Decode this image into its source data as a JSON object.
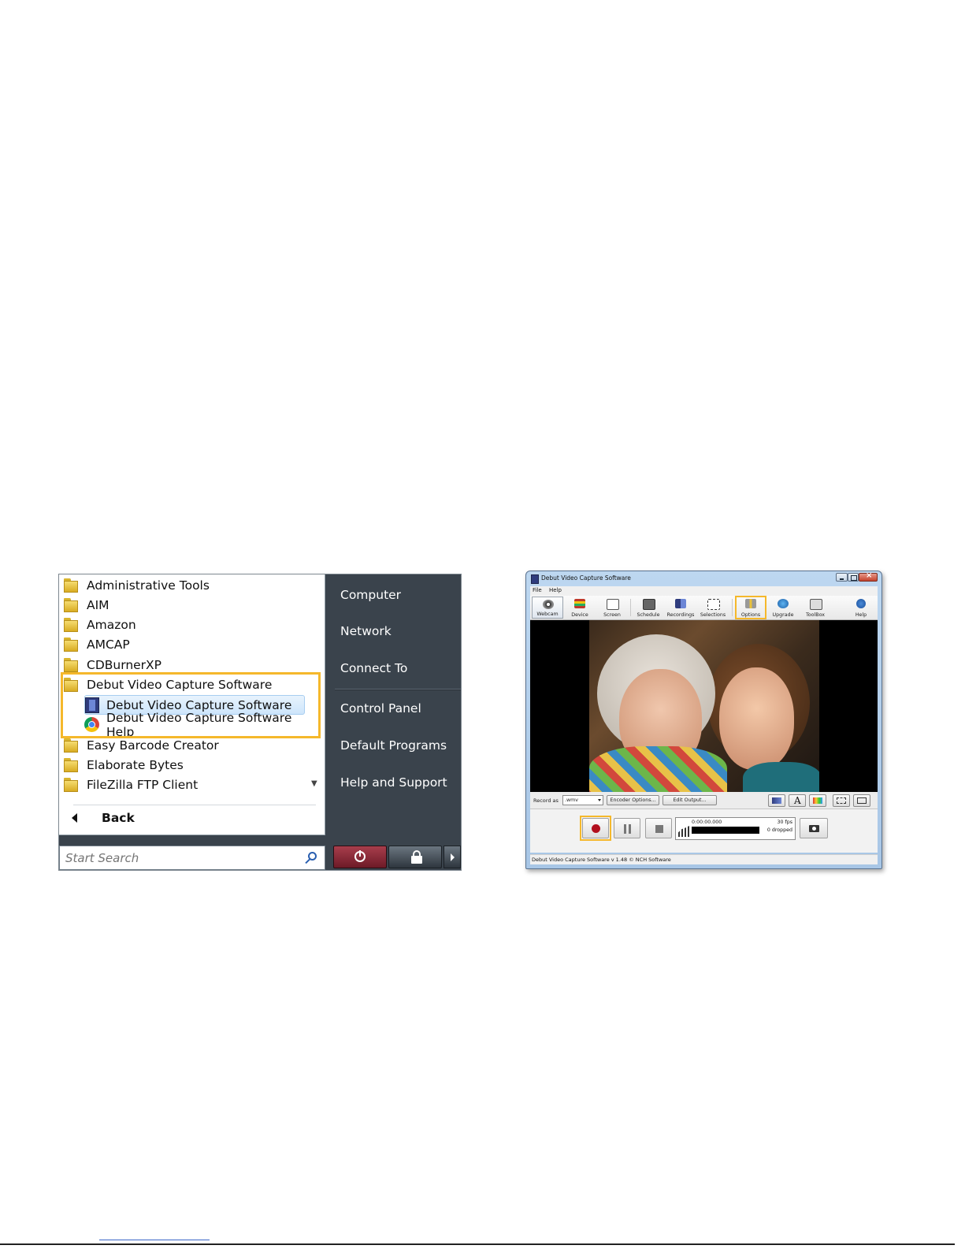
{
  "start_menu": {
    "programs": [
      {
        "label": "Administrative Tools",
        "type": "folder"
      },
      {
        "label": "AIM",
        "type": "folder"
      },
      {
        "label": "Amazon",
        "type": "folder"
      },
      {
        "label": "AMCAP",
        "type": "folder"
      },
      {
        "label": "CDBurnerXP",
        "type": "folder"
      },
      {
        "label": "Debut Video Capture Software",
        "type": "folder"
      },
      {
        "label": "Debut Video Capture Software",
        "type": "app",
        "icon": "film-icon"
      },
      {
        "label": "Debut Video Capture Software Help",
        "type": "app",
        "icon": "chrome-icon"
      },
      {
        "label": "Easy Barcode Creator",
        "type": "folder"
      },
      {
        "label": "Elaborate Bytes",
        "type": "folder"
      },
      {
        "label": "FileZilla FTP Client",
        "type": "folder"
      }
    ],
    "back_label": "Back",
    "search_placeholder": "Start Search",
    "right_items": [
      {
        "label": "Computer"
      },
      {
        "label": "Network"
      },
      {
        "label": "Connect To"
      },
      {
        "label": "Control Panel"
      },
      {
        "label": "Default Programs"
      },
      {
        "label": "Help and Support"
      }
    ],
    "highlight_color": "#f5b82b"
  },
  "debut_window": {
    "title": "Debut Video Capture Software",
    "menu": [
      {
        "label": "File"
      },
      {
        "label": "Help"
      }
    ],
    "toolbar": [
      {
        "label": "Webcam",
        "icon": "webcam-icon"
      },
      {
        "label": "Device",
        "icon": "device-icon"
      },
      {
        "label": "Screen",
        "icon": "screen-icon"
      },
      {
        "label": "Schedule",
        "icon": "schedule-icon"
      },
      {
        "label": "Recordings",
        "icon": "recordings-icon"
      },
      {
        "label": "Selections",
        "icon": "selections-icon"
      },
      {
        "label": "Options",
        "icon": "options-icon"
      },
      {
        "label": "Upgrade",
        "icon": "upgrade-icon"
      },
      {
        "label": "ToolBox",
        "icon": "toolbox-icon"
      },
      {
        "label": "Help",
        "icon": "help-icon"
      }
    ],
    "record_as_label": "Record as",
    "format_value": ".wmv",
    "encoder_options_label": "Encoder Options...",
    "edit_output_label": "Edit Output...",
    "time": "0:00:00.000",
    "fps": "30 fps",
    "dropped": "0 dropped",
    "status_text": "Debut Video Capture Software v 1.48 © NCH Software"
  }
}
